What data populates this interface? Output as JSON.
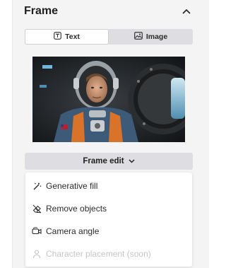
{
  "section": {
    "title": "Frame",
    "collapse_icon": "chevron-up-icon"
  },
  "mode_toggle": {
    "options": [
      {
        "label": "Text",
        "icon": "text-icon",
        "active": true
      },
      {
        "label": "Image",
        "icon": "image-icon",
        "active": false
      }
    ]
  },
  "preview": {
    "alt": "Astronaut in spacesuit inside spacecraft"
  },
  "frame_edit": {
    "label": "Frame edit",
    "icon": "chevron-down-icon"
  },
  "menu": {
    "items": [
      {
        "label": "Generative fill",
        "icon": "magic-wand-icon",
        "enabled": true
      },
      {
        "label": "Remove objects",
        "icon": "eraser-icon",
        "enabled": true
      },
      {
        "label": "Camera angle",
        "icon": "camera-icon",
        "enabled": true
      },
      {
        "label": "Character placement (soon)",
        "icon": "person-icon",
        "enabled": false
      }
    ]
  },
  "colors": {
    "panel_bg": "#f4f4f5",
    "toggle_bg": "#dedee2",
    "text": "#1f1f1f",
    "disabled_text": "#c4c4c8"
  }
}
